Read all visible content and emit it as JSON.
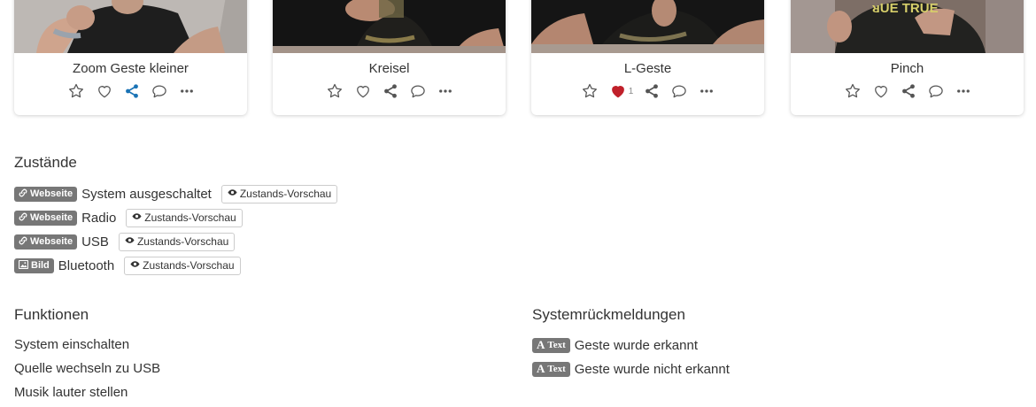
{
  "cards": [
    {
      "title": "Zoom Geste kleiner",
      "shared": true,
      "liked": false,
      "likes": ""
    },
    {
      "title": "Kreisel",
      "shared": false,
      "liked": false,
      "likes": ""
    },
    {
      "title": "L-Geste",
      "shared": false,
      "liked": true,
      "likes": "1"
    },
    {
      "title": "Pinch",
      "shared": false,
      "liked": false,
      "likes": ""
    }
  ],
  "card4_shirt_text": "ᴚUE TRUE",
  "states": {
    "heading": "Zustände",
    "items": [
      {
        "badge": "Webseite",
        "badge_icon": "link-icon",
        "label": "System ausgeschaltet",
        "preview": "Zustands-Vorschau"
      },
      {
        "badge": "Webseite",
        "badge_icon": "link-icon",
        "label": "Radio",
        "preview": "Zustands-Vorschau"
      },
      {
        "badge": "Webseite",
        "badge_icon": "link-icon",
        "label": "USB",
        "preview": "Zustands-Vorschau"
      },
      {
        "badge": "Bild",
        "badge_icon": "image-icon",
        "label": "Bluetooth",
        "preview": "Zustands-Vorschau"
      }
    ]
  },
  "functions": {
    "heading": "Funktionen",
    "items": [
      "System einschalten",
      "Quelle wechseln zu USB",
      "Musik lauter stellen"
    ]
  },
  "feedback": {
    "heading": "Systemrückmeldungen",
    "items": [
      {
        "badge": "Text",
        "label": "Geste wurde erkannt"
      },
      {
        "badge": "Text",
        "label": "Geste wurde nicht erkannt"
      }
    ]
  },
  "colors": {
    "accent": "#1a73b5",
    "heart": "#c0202a",
    "badge_bg": "#777777"
  }
}
